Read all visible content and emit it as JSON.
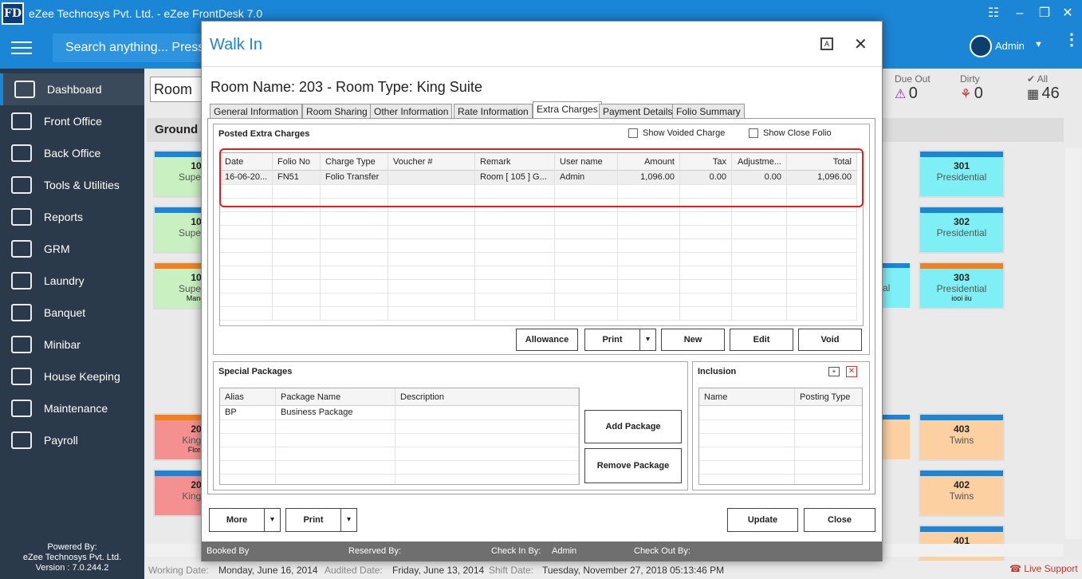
{
  "app": {
    "logo": "FD",
    "title": "eZee Technosys Pvt. Ltd. - eZee FrontDesk 7.0",
    "translate_icon": "translate-icon",
    "minimize_icon": "minimize-icon",
    "maximize_icon": "maximize-icon",
    "close_icon": "close-icon"
  },
  "topbar": {
    "search_placeholder": "Search anything... Press",
    "user": "Admin",
    "caret": "▼",
    "more": "⋮"
  },
  "sidebar": {
    "items": [
      {
        "label": "Dashboard",
        "icon": "chart-icon"
      },
      {
        "label": "Front Office",
        "icon": "person-icon"
      },
      {
        "label": "Back Office",
        "icon": "building-icon"
      },
      {
        "label": "Tools & Utilities",
        "icon": "tools-icon"
      },
      {
        "label": "Reports",
        "icon": "report-icon"
      },
      {
        "label": "GRM",
        "icon": "grm-icon"
      },
      {
        "label": "Laundry",
        "icon": "iron-icon"
      },
      {
        "label": "Banquet",
        "icon": "cutlery-icon"
      },
      {
        "label": "Minibar",
        "icon": "minibar-icon"
      },
      {
        "label": "House Keeping",
        "icon": "housekeeping-icon"
      },
      {
        "label": "Maintenance",
        "icon": "maintenance-icon"
      },
      {
        "label": "Payroll",
        "icon": "payroll-icon"
      }
    ],
    "powered_by": "Powered By:",
    "company": "eZee Technosys Pvt. Ltd.",
    "version": "Version : 7.0.244.2"
  },
  "background": {
    "room_select": "Room V",
    "floor": "Ground",
    "stats": [
      {
        "label": "Due Out",
        "value": "0"
      },
      {
        "label": "Dirty",
        "value": "0"
      },
      {
        "label": "✔ All",
        "value": "46"
      }
    ],
    "rooms_left": [
      {
        "num": "10",
        "type": "Super D",
        "guest": "",
        "color": "#c8f0c0",
        "bar": "#1b85d6"
      },
      {
        "num": "10",
        "type": "Super D",
        "guest": "",
        "color": "#c8f0c0",
        "bar": "#1b85d6"
      },
      {
        "num": "10",
        "type": "Super D",
        "guest": "Manoj",
        "color": "#c8f0c0",
        "bar": "#f08020"
      },
      {
        "num": "20",
        "type": "King S",
        "guest": "Flora",
        "color": "#f59090",
        "bar": "#f08020"
      },
      {
        "num": "20",
        "type": "King S",
        "guest": "",
        "color": "#f59090",
        "bar": "#1b85d6"
      }
    ],
    "rooms_right": [
      {
        "num": "301",
        "type": "Presidential",
        "guest": "",
        "color": "#7ef0f5",
        "bar": "#1b85d6"
      },
      {
        "num": "302",
        "type": "Presidential",
        "guest": "",
        "color": "#7ef0f5",
        "bar": "#1b85d6"
      },
      {
        "num": "303",
        "type": "Presidential",
        "guest": "iooi iiu",
        "color": "#7ef0f5",
        "bar": "#f08020"
      },
      {
        "num": "403",
        "type": "Twins",
        "guest": "",
        "color": "#fcd0a0",
        "bar": "#1b85d6"
      },
      {
        "num": "402",
        "type": "Twins",
        "guest": "",
        "color": "#fcd0a0",
        "bar": "#1b85d6"
      },
      {
        "num": "401",
        "type": "",
        "guest": "",
        "color": "#fcd0a0",
        "bar": "#1b85d6"
      }
    ],
    "partial_room_label": "al",
    "status": {
      "working_label": "Working Date:",
      "working": "Monday, June 16, 2014",
      "audited_label": "Audited Date:",
      "audited": "Friday, June 13, 2014",
      "shift_label": "Shift Date:",
      "shift": "Tuesday, November 27, 2018 05:13:46 PM",
      "live_support": "Live Support"
    }
  },
  "modal": {
    "title": "Walk In",
    "close": "✕",
    "room_heading": "Room Name: 203 - Room Type: King Suite",
    "tabs": [
      "General Information",
      "Room Sharing",
      "Other Information",
      "Rate Information",
      "Extra Charges",
      "Payment Details",
      "Folio Summary"
    ],
    "active_tab": "Extra Charges",
    "posted": {
      "title": "Posted Extra Charges",
      "show_voided": "Show Voided Charge",
      "show_close_folio": "Show Close Folio",
      "columns": [
        "Date",
        "Folio No",
        "Charge Type",
        "Voucher #",
        "Remark",
        "User name",
        "Amount",
        "Tax",
        "Adjustme...",
        "Total"
      ],
      "rows": [
        [
          "16-06-20...",
          "FN51",
          "Folio Transfer",
          "",
          "Room [ 105 ] G...",
          "Admin",
          "1,096.00",
          "0.00",
          "0.00",
          "1,096.00"
        ]
      ],
      "buttons": {
        "allowance": "Allowance",
        "print": "Print",
        "new": "New",
        "edit": "Edit",
        "void": "Void",
        "dropdown": "▾"
      }
    },
    "packages": {
      "title": "Special Packages",
      "columns": [
        "Alias",
        "Package Name",
        "Description"
      ],
      "rows": [
        [
          "BP",
          "Business Package",
          ""
        ]
      ],
      "add": "Add Package",
      "remove": "Remove Package"
    },
    "inclusion": {
      "title": "Inclusion",
      "columns": [
        "Name",
        "Posting Type"
      ]
    },
    "footer_buttons": {
      "more": "More",
      "print": "Print",
      "update": "Update",
      "close": "Close",
      "dropdown": "▾"
    },
    "footer": {
      "booked_by": "Booked By",
      "reserved_by": "Reserved By:",
      "check_in_by": "Check In By:",
      "check_in_value": "Admin",
      "check_out_by": "Check Out By:"
    }
  }
}
